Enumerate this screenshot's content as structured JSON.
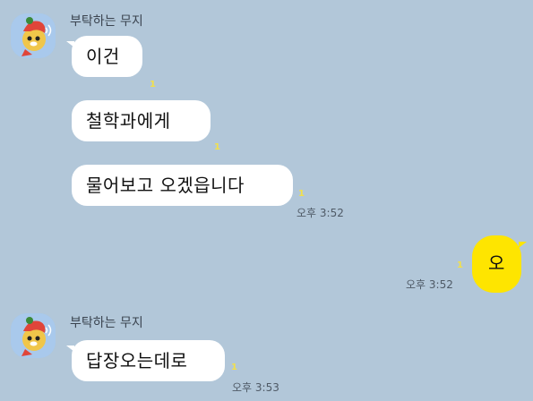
{
  "chat": {
    "groups": [
      {
        "sender": "부탁하는 무지",
        "messages": [
          {
            "text": "이건",
            "unread": "1"
          },
          {
            "text": "철학과에게",
            "unread": "1"
          },
          {
            "text": "물어보고 오겠읍니다",
            "unread": "1",
            "time": "오후 3:52"
          }
        ]
      },
      {
        "mine": true,
        "messages": [
          {
            "text": "오",
            "unread": "1",
            "time": "오후 3:52"
          }
        ]
      },
      {
        "sender": "부탁하는 무지",
        "messages": [
          {
            "text": "답장오는데로",
            "unread": "1",
            "time": "오후 3:53"
          }
        ]
      }
    ]
  },
  "colors": {
    "background": "#b2c7d9",
    "my_bubble": "#fee500",
    "their_bubble": "#ffffff",
    "unread": "#f2e04a"
  },
  "icons": {
    "avatar": "muzi-profile-icon"
  }
}
